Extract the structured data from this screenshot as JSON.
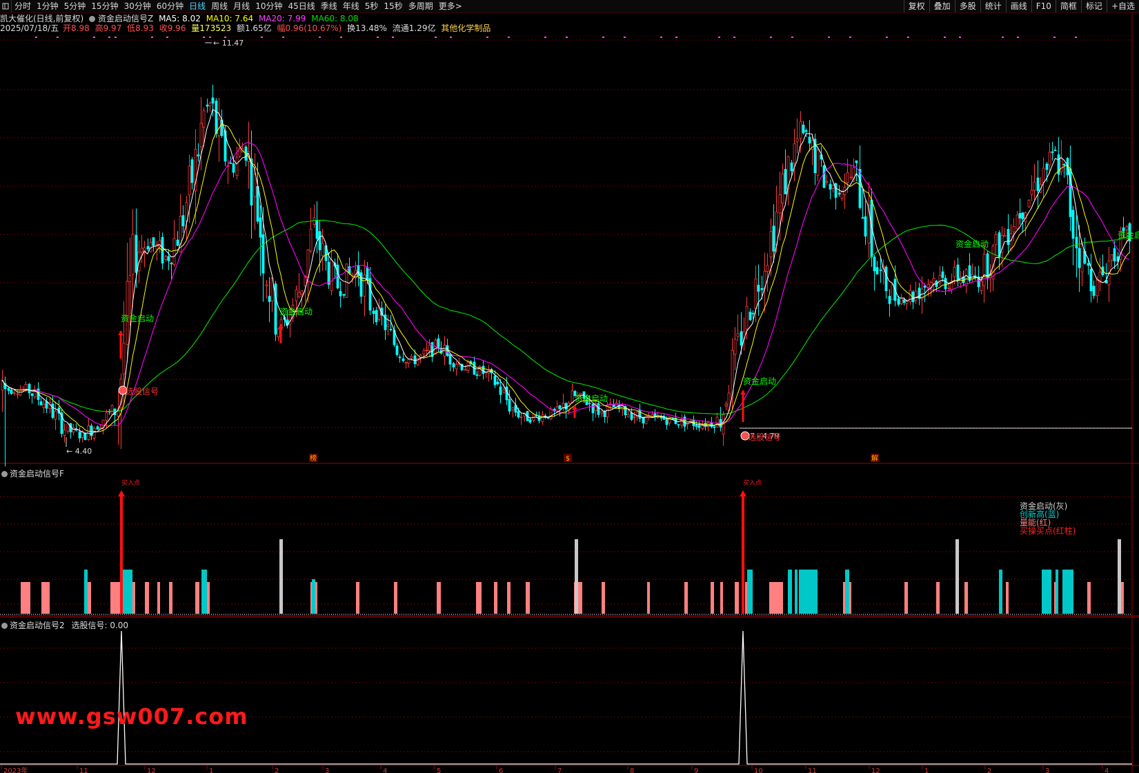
{
  "toolbar": {
    "periods": [
      "分时",
      "1分钟",
      "5分钟",
      "15分钟",
      "30分钟",
      "60分钟",
      "日线",
      "周线",
      "月线",
      "10分钟",
      "45日线",
      "季线",
      "年线",
      "5秒",
      "15秒",
      "多周期",
      "更多>"
    ],
    "active": "日线",
    "right_buttons": [
      "复权",
      "叠加",
      "多股",
      "统计",
      "画线",
      "F10",
      "简框",
      "标记",
      "+自选"
    ]
  },
  "header": {
    "stock_name": "凯大催化(日线,前复权)",
    "indicator": "资金启动信号Z",
    "ma5": "MA5: 8.02",
    "ma10": "MA10: 7.64",
    "ma20": "MA20: 7.99",
    "ma60": "MA60: 8.08",
    "date": "2025/07/18/五",
    "open": "开8.98",
    "high": "高9.97",
    "low": "低8.93",
    "close": "收9.96",
    "volume": "量173523",
    "amount": "额1.65亿",
    "change": "幅0.96(10.67%)",
    "turnover": "换13.48%",
    "float": "流通1.29亿",
    "sector": "其他化学制品"
  },
  "colors": {
    "up": "#ff3b3b",
    "down": "#00ffff",
    "ma5": "#ffffff",
    "ma10": "#ffff00",
    "ma20": "#ff00ff",
    "ma60": "#00e000",
    "bar_pink": "#ff8080",
    "bar_cyan": "#00c8c8",
    "bar_gray": "#c8c8c8",
    "signal_red": "#ff1010",
    "label_green": "#00ff00",
    "grid": "#700000"
  },
  "main_chart": {
    "max_label": "11.47",
    "min_label": "4.40",
    "range_label": "77 - 4.79",
    "signal_labels": [
      "资金启动",
      "资金启动",
      "资金启动",
      "资金启动",
      "资金启动",
      "资金启动"
    ],
    "select_labels": [
      "选股信号",
      "选股信号"
    ],
    "event_marks": [
      "榜",
      "$",
      "解"
    ]
  },
  "panel2": {
    "title": "资金启动信号F",
    "arrow_labels": [
      "买入点",
      "买入点"
    ],
    "legend": [
      "资金启动(灰)",
      "创新高(蓝)",
      "量能(红)",
      "买操买点(红柱)"
    ]
  },
  "panel3": {
    "title": "资金启动信号2",
    "value": "选股信号: 0.00"
  },
  "chart_data": {
    "type": "line",
    "series": [
      {
        "name": "选股信号",
        "values": [
          0,
          1,
          0,
          1,
          0
        ]
      }
    ],
    "ylim": [
      0,
      1
    ]
  },
  "watermark": "www.gsw007.com",
  "bottom_axis_labels": [
    "2023年",
    "11",
    "12",
    "1",
    "2",
    "3",
    "4",
    "5",
    "6",
    "7",
    "8",
    "9",
    "10",
    "11",
    "12",
    "1",
    "2",
    "3",
    "4"
  ]
}
